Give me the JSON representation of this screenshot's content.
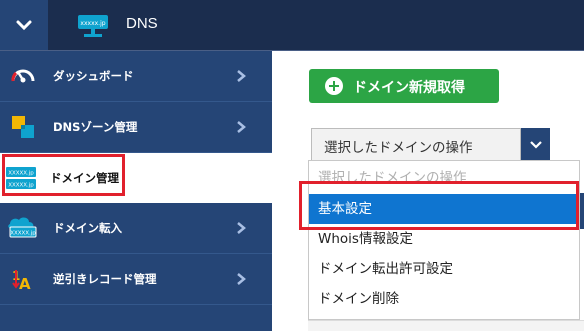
{
  "header": {
    "title": "DNS",
    "logo_text": "xxxxx.jp",
    "menu_icon": "chevron-down-icon"
  },
  "sidebar": {
    "items": [
      {
        "label": "ダッシュボード",
        "icon": "speedometer-icon"
      },
      {
        "label": "DNSゾーン管理",
        "icon": "dns-zone-icon"
      },
      {
        "label": "ドメイン管理",
        "icon": "domain-list-icon",
        "active": true,
        "icon_text": [
          "XXXXX.jp",
          "XXXXX.jp"
        ]
      },
      {
        "label": "ドメイン転入",
        "icon": "domain-transfer-icon",
        "icon_text": "XXXXX.jp"
      },
      {
        "label": "逆引きレコード管理",
        "icon": "reverse-record-icon"
      }
    ]
  },
  "main": {
    "add_button_label": "ドメイン新規取得",
    "select": {
      "value": "選択したドメインの操作",
      "options": [
        {
          "label": "選択したドメインの操作",
          "disabled": true
        },
        {
          "label": "基本設定",
          "selected": true
        },
        {
          "label": "Whois情報設定"
        },
        {
          "label": "ドメイン転出許可設定"
        },
        {
          "label": "ドメイン削除"
        }
      ]
    }
  },
  "colors": {
    "header_bg": "#1b2d4e",
    "sidebar_bg": "#254576",
    "accent_green": "#2ca545",
    "selected_blue": "#0f75d0",
    "highlight_red": "#e1202c"
  }
}
